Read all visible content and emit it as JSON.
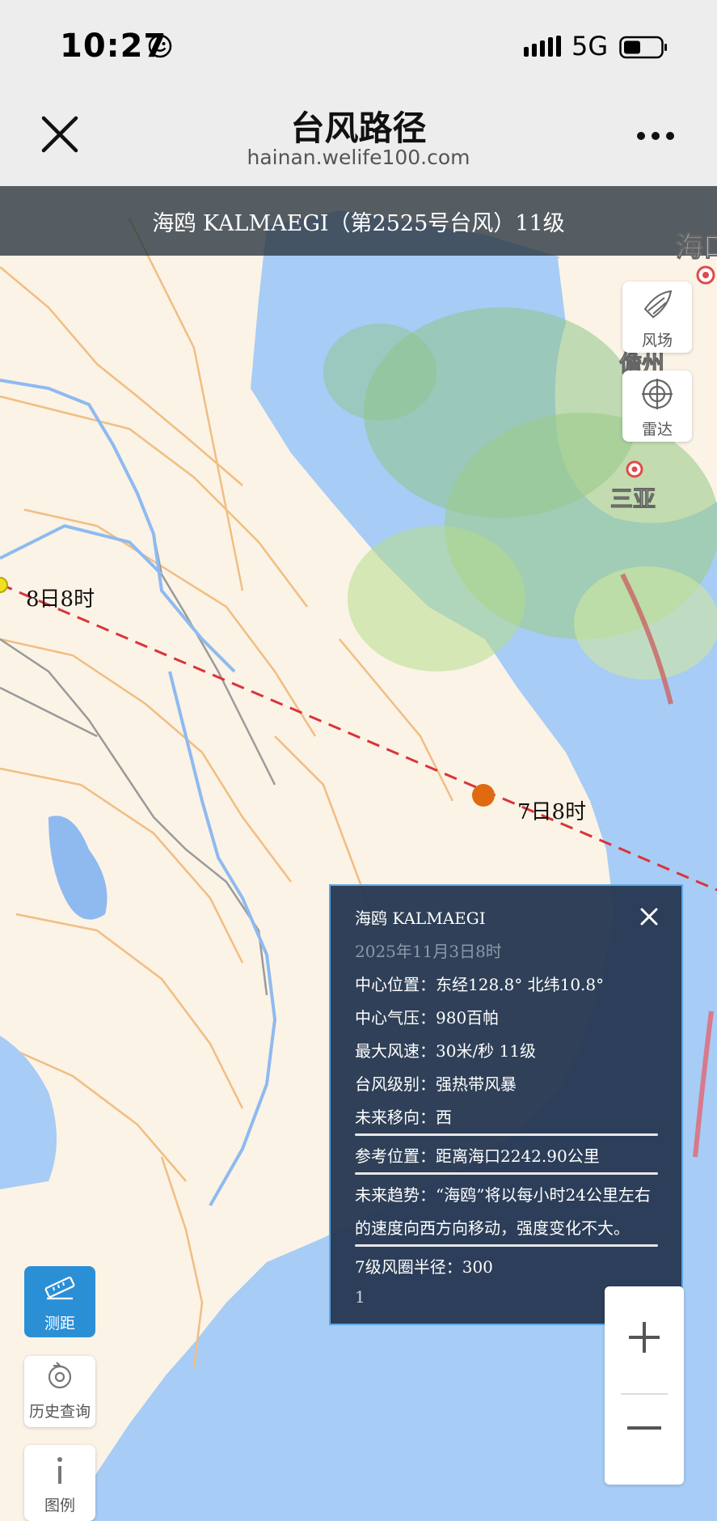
{
  "status": {
    "time": "10:27",
    "network": "5G"
  },
  "nav": {
    "title": "台风路径",
    "subtitle": "hainan.welife100.com"
  },
  "typhoon": {
    "banner": "海鸥 KALMAEGI（第2525号台风）11级"
  },
  "map": {
    "labels": {
      "point_8th": "8日8时",
      "point_7th": "7日8时"
    },
    "cities": {
      "danzhou": "儋州",
      "sanya": "三亚",
      "haikou_partial": "海口"
    },
    "buttons": {
      "wind": "风场",
      "radar": "雷达"
    },
    "tools": {
      "measure": "测距",
      "history": "历史查询",
      "legend": "图例"
    },
    "zoom": {
      "in": "+",
      "out": "—"
    }
  },
  "popup": {
    "name": "海鸥 KALMAEGI",
    "time": "2025年11月3日8时",
    "center": "中心位置：东经128.8° 北纬10.8°",
    "pressure": "中心气压：980百帕",
    "wind": "最大风速：30米/秒 11级",
    "level": "台风级别：强热带风暴",
    "direction": "未来移向：西",
    "reference": "参考位置：距离海口2242.90公里",
    "trend_line1": "未来趋势：“海鸥”将以每小时24公里左右",
    "trend_line2": "的速度向西方向移动，强度变化不大。",
    "radius7": "7级风圈半径：300",
    "extra": "1"
  },
  "colors": {
    "track": "#d9343a",
    "point_7th": "#e06a10",
    "point_8th": "#f0e020",
    "popup_bg": "#263852",
    "water": "#a7ccf5",
    "land": "#fbf3e6"
  }
}
